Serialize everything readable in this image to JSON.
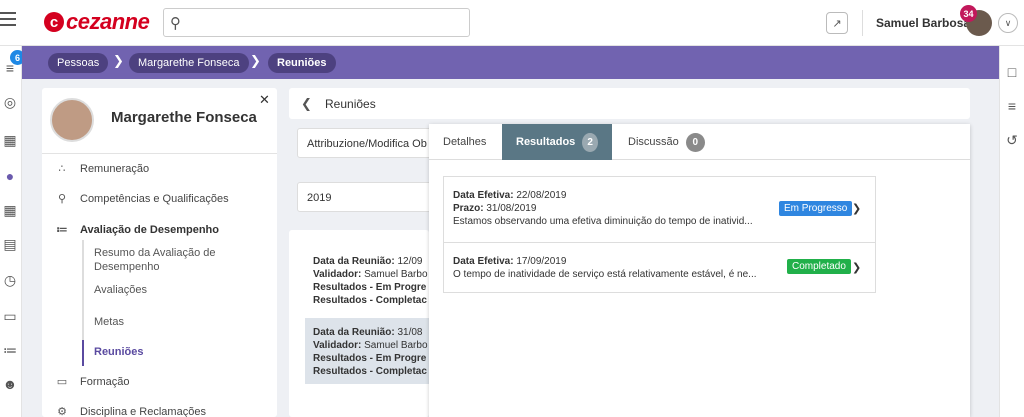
{
  "app": {
    "logo_text": "cezanne",
    "logo_mark": "c",
    "brand_color": "#d4001f"
  },
  "topbar": {
    "search_placeholder": "",
    "user_name": "Samuel Barbosa",
    "notifications_count": "34"
  },
  "leftrail": {
    "badge_count": "6"
  },
  "breadcrumb": [
    "Pessoas",
    "Margarethe Fonseca",
    "Reuniões"
  ],
  "employee": {
    "name": "Margarethe Fonseca",
    "menu": [
      {
        "label": "Remuneração",
        "icon": "coins-icon"
      },
      {
        "label": "Competências e Qualificações",
        "icon": "award-icon"
      },
      {
        "label": "Avaliação de Desempenho",
        "icon": "chart-icon"
      }
    ],
    "submenu": [
      "Resumo da Avaliação de Desempenho",
      "Avaliações",
      "Metas",
      "Reuniões"
    ],
    "menu_after": [
      {
        "label": "Formação",
        "icon": "book-icon"
      },
      {
        "label": "Disciplina e Reclamações",
        "icon": "gavel-icon"
      }
    ]
  },
  "main": {
    "header_title": "Reuniões",
    "filter_type": "Attribuzione/Modifica Ob",
    "filter_year": "2019",
    "meetings": [
      {
        "date_label": "Data da Reunião:",
        "date": "12/09",
        "validator_label": "Validador:",
        "validator": "Samuel Barbo",
        "progress_label": "Resultados - Em Progre",
        "completed_label": "Resultados - Completac"
      },
      {
        "date_label": "Data da Reunião:",
        "date": "31/08",
        "validator_label": "Validador:",
        "validator": "Samuel Barbo",
        "progress_label": "Resultados - Em Progre",
        "completed_label": "Resultados - Completac"
      }
    ]
  },
  "popup": {
    "tabs": [
      {
        "label": "Detalhes"
      },
      {
        "label": "Resultados",
        "count": "2"
      },
      {
        "label": "Discussão",
        "count": "0"
      }
    ],
    "results": [
      {
        "effective_label": "Data Efetiva:",
        "effective": "22/08/2019",
        "deadline_label": "Prazo:",
        "deadline": "31/08/2019",
        "description": "Estamos observando uma efetiva diminuição do tempo de inativid...",
        "status": "Em Progresso",
        "status_color": "#2f86e0"
      },
      {
        "effective_label": "Data Efetiva:",
        "effective": "17/09/2019",
        "description": "O tempo de inatividade de serviço está relativamente estável, é ne...",
        "status": "Completado",
        "status_color": "#21b04a"
      }
    ]
  },
  "colors": {
    "breadcrumb_bg": "#7163b0",
    "active_tab_bg": "#5a7785"
  }
}
